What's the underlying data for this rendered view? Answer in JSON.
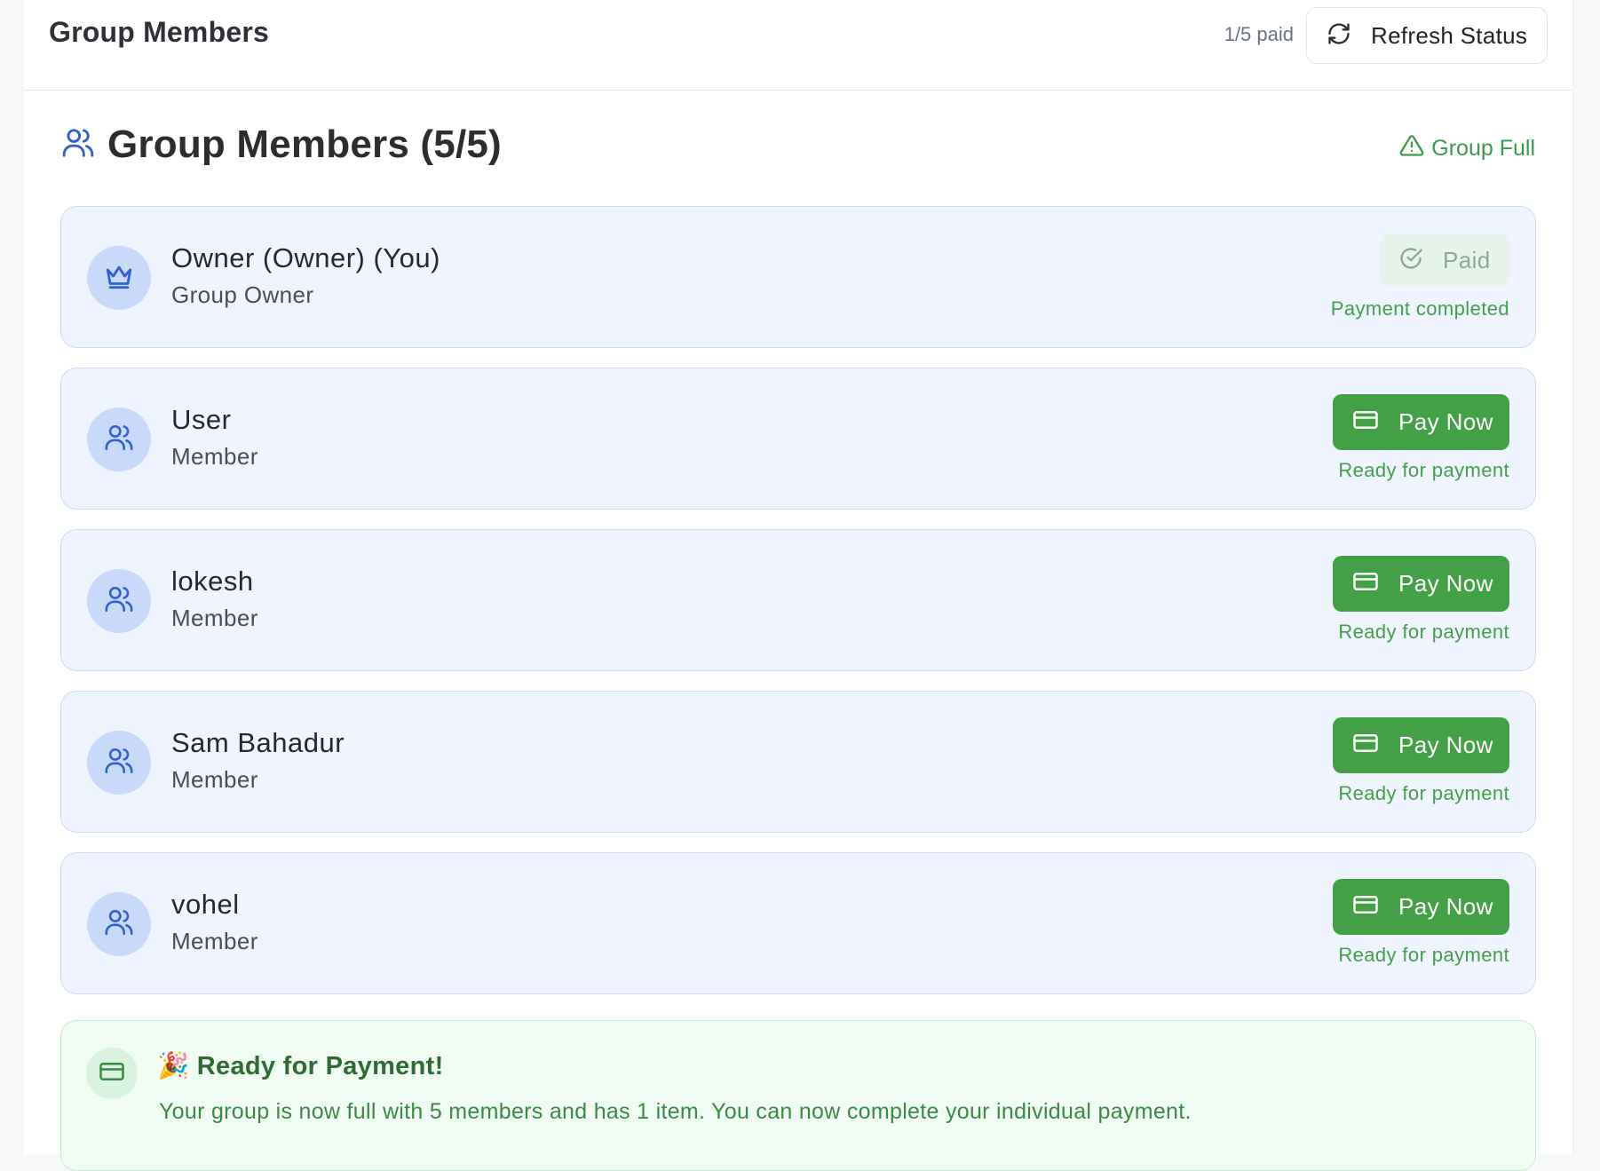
{
  "header": {
    "title": "Group Members",
    "paid_count": "1/5 paid",
    "refresh_label": "Refresh Status"
  },
  "section": {
    "title": "Group Members (5/5)",
    "status": "Group Full"
  },
  "members": [
    {
      "name": "Owner (Owner) (You)",
      "role": "Group Owner",
      "icon": "crown-icon",
      "action": "Paid",
      "status": "Payment completed"
    },
    {
      "name": "User",
      "role": "Member",
      "icon": "users-icon",
      "action": "Pay Now",
      "status": "Ready for payment"
    },
    {
      "name": "lokesh",
      "role": "Member",
      "icon": "users-icon",
      "action": "Pay Now",
      "status": "Ready for payment"
    },
    {
      "name": "Sam Bahadur",
      "role": "Member",
      "icon": "users-icon",
      "action": "Pay Now",
      "status": "Ready for payment"
    },
    {
      "name": "vohel",
      "role": "Member",
      "icon": "users-icon",
      "action": "Pay Now",
      "status": "Ready for payment"
    }
  ],
  "banner": {
    "emoji": "🎉",
    "title": "Ready for Payment!",
    "text": "Your group is now full with 5 members and has 1 item. You can now complete your individual payment."
  },
  "colors": {
    "accent_blue": "#2f5fd0",
    "success_green": "#43a047",
    "card_bg": "#eff4fe",
    "banner_bg": "#f0fbf3"
  }
}
